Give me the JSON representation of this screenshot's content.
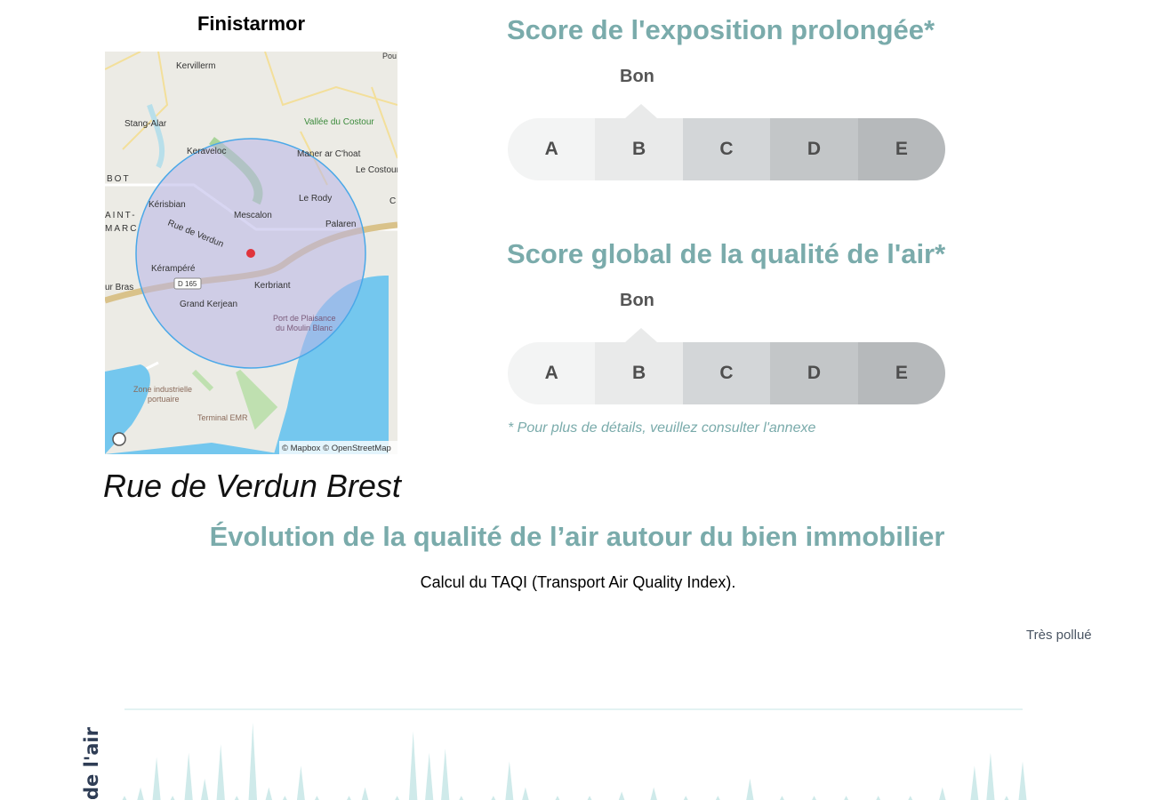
{
  "map_card": {
    "title": "Finistarmor",
    "address": "Rue de Verdun Brest",
    "attribution": "© Mapbox © OpenStreetMap",
    "labels": {
      "kervillerm": "Kervillerm",
      "stang_alar": "Stang-Alar",
      "vallee": "Vallée du Costour",
      "keraveloc": "Keraveloc",
      "maner": "Maner ar C'hoat",
      "le_costour": "Le Costour",
      "bot": "BOT",
      "kerisbian": "Kérisbian",
      "le_rody": "Le Rody",
      "mescalon": "Mescalon",
      "saint": "AINT-",
      "marc": "MARC",
      "palaren": "Palaren",
      "rue_verdun": "Rue de Verdun",
      "kerampere": "Kérampéré",
      "ur_bras": "ur Bras",
      "d165": "D 165",
      "kerbriant": "Kerbriant",
      "grand_kerjean": "Grand Kerjean",
      "port1": "Port de Plaisance",
      "port2": "du Moulin Blanc",
      "zone1": "Zone industrielle",
      "zone2": "portuaire",
      "terminal": "Terminal EMR",
      "pou": "Pou",
      "c": "C"
    },
    "colors": {
      "circle": "#4aa8e8",
      "marker": "#e0343c",
      "water": "#74c7ee"
    }
  },
  "scores": [
    {
      "title": "Score de l'exposition prolongée*",
      "value_label": "Bon",
      "selected": "B",
      "grades": [
        "A",
        "B",
        "C",
        "D",
        "E"
      ]
    },
    {
      "title": "Score global de la qualité de l'air*",
      "value_label": "Bon",
      "selected": "B",
      "grades": [
        "A",
        "B",
        "C",
        "D",
        "E"
      ]
    }
  ],
  "grade_colors": [
    "#f3f4f4",
    "#e9eaea",
    "#d3d6d8",
    "#c3c6c8",
    "#b6b9bb"
  ],
  "note": "* Pour plus de détails, veuillez consulter l'annexe",
  "evolution": {
    "title": "Évolution de la qualité de l’air autour du bien immobilier",
    "subtitle": "Calcul du TAQI (Transport Air Quality Index)."
  },
  "chart_data": {
    "type": "area",
    "top_label": "Très pollué",
    "ylabel": "de l'air",
    "values": [
      0.1,
      0.2,
      0.55,
      0.1,
      0.6,
      0.3,
      0.7,
      0.1,
      0.95,
      0.2,
      0.1,
      0.45,
      0.1,
      0.05,
      0.1,
      0.2,
      0.05,
      0.1,
      0.85,
      0.6,
      0.65,
      0.1,
      0.05,
      0.1,
      0.5,
      0.2,
      0.05,
      0.1,
      0.05,
      0.1,
      0.05,
      0.15,
      0.05,
      0.2,
      0.05,
      0.1,
      0.05,
      0.1,
      0.05,
      0.3,
      0.05,
      0.1,
      0.05,
      0.1,
      0.05,
      0.1,
      0.05,
      0.1,
      0.05,
      0.1,
      0.05,
      0.2,
      0.05,
      0.45,
      0.6,
      0.1,
      0.5
    ],
    "colors": {
      "area": "#cfeaea",
      "gridline": "#e3f2f2"
    }
  }
}
